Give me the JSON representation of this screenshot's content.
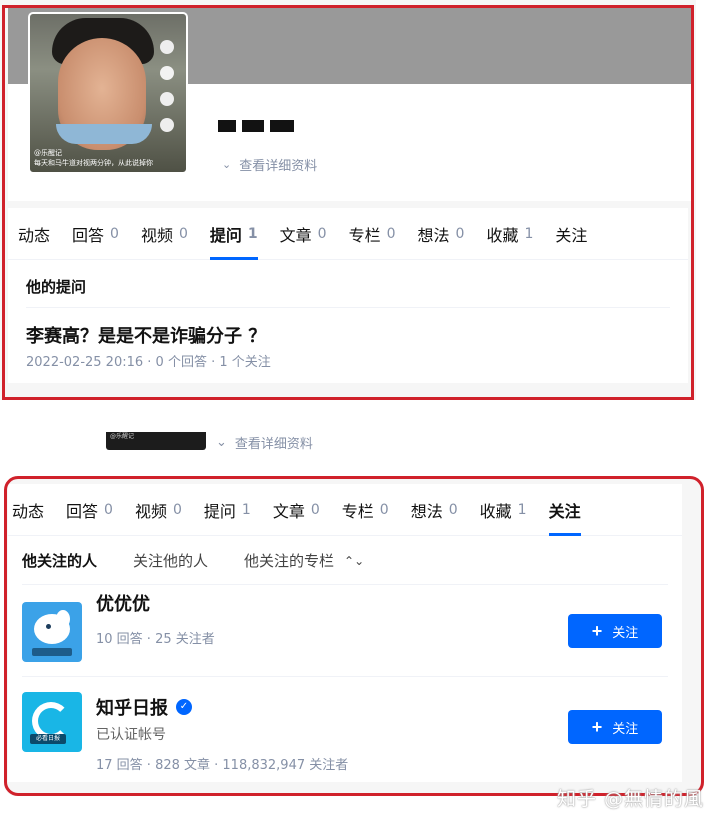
{
  "top": {
    "avatar_caption": "@乐醒记\n每天和马牛道对视两分钟，从此说掉你",
    "view_details": "查看详细资料",
    "tabs": [
      {
        "label": "动态",
        "count": ""
      },
      {
        "label": "回答",
        "count": "0"
      },
      {
        "label": "视频",
        "count": "0"
      },
      {
        "label": "提问",
        "count": "1"
      },
      {
        "label": "文章",
        "count": "0"
      },
      {
        "label": "专栏",
        "count": "0"
      },
      {
        "label": "想法",
        "count": "0"
      },
      {
        "label": "收藏",
        "count": "1"
      },
      {
        "label": "关注",
        "count": ""
      }
    ],
    "active_tab": "提问",
    "section_title": "他的提问",
    "question": {
      "title": "李赛高？是是不是诈骗分子 ？",
      "meta": "2022-02-25 20:16 · 0 个回答 · 1 个关注"
    }
  },
  "middle": {
    "view_details": "查看详细资料"
  },
  "bottom": {
    "tabs": [
      {
        "label": "动态",
        "count": ""
      },
      {
        "label": "回答",
        "count": "0"
      },
      {
        "label": "视频",
        "count": "0"
      },
      {
        "label": "提问",
        "count": "1"
      },
      {
        "label": "文章",
        "count": "0"
      },
      {
        "label": "专栏",
        "count": "0"
      },
      {
        "label": "想法",
        "count": "0"
      },
      {
        "label": "收藏",
        "count": "1"
      },
      {
        "label": "关注",
        "count": ""
      }
    ],
    "active_tab": "关注",
    "subtabs": [
      "他关注的人",
      "关注他的人",
      "他关注的专栏"
    ],
    "items": [
      {
        "name": "优优优",
        "desc": "",
        "stats": "10 回答 · 25 关注者",
        "button": "关注"
      },
      {
        "name": "知乎日报",
        "desc": "已认证帐号",
        "stats": "17 回答 · 828 文章 · 118,832,947 关注者",
        "button": "关注"
      }
    ],
    "daily_logo_text": "必看日报"
  },
  "watermark": "知乎 @無情的風",
  "colors": {
    "accent": "#0066ff",
    "highlight_border": "#d0212b",
    "muted": "#8590a6"
  }
}
